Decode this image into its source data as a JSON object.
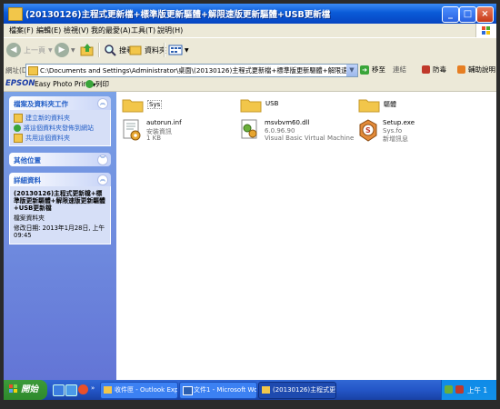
{
  "window": {
    "title": "(20130126)主程式更新檔+標準版更新驅體+解限速版更新驅體+USB更新檔"
  },
  "menu": [
    "檔案(F)",
    "編輯(E)",
    "檢視(V)",
    "我的最愛(A)",
    "工具(T)",
    "說明(H)"
  ],
  "toolbar": {
    "back": "上一頁",
    "search": "搜尋",
    "folders": "資料夾"
  },
  "address": {
    "label": "網址(D)",
    "path": "C:\\Documents and Settings\\Administrator\\桌面\\(20130126)主程式更新檔+標準版更新驅體+解限速版更新驅體+USB更新檔",
    "go": "移至",
    "links": "連結",
    "antivirus": "防毒",
    "help": "輔助說明"
  },
  "epson": {
    "logo": "EPSON",
    "app": "Easy Photo Print",
    "print": "列印"
  },
  "tasks_panel": {
    "title": "檔案及資料夾工作",
    "items": [
      "建立新的資料夾",
      "將這個資料夾發佈到網站",
      "共用這個資料夾"
    ]
  },
  "other_panel": {
    "title": "其他位置"
  },
  "details_panel": {
    "title": "詳細資料",
    "name": "(20130126)主程式更新檔+標準版更新驅體+解限速版更新驅體+USB更新檔",
    "type": "檔案資料夾",
    "modified": "修改日期: 2013年1月28日, 上午 09:45"
  },
  "files": [
    {
      "name": "Sys",
      "type": "folder"
    },
    {
      "name": "USB",
      "type": "folder"
    },
    {
      "name": "驅體",
      "type": "folder"
    },
    {
      "name": "autorun.inf",
      "line2": "安裝資訊",
      "line3": "1 KB",
      "type": "inf"
    },
    {
      "name": "msvbvm60.dll",
      "line2": "6.0.96.90",
      "line3": "Visual Basic Virtual Machine",
      "type": "dll"
    },
    {
      "name": "Setup.exe",
      "line2": "Sys.fo",
      "line3": "新增訊息",
      "type": "exe"
    }
  ],
  "taskbar": {
    "start": "開始",
    "tasks": [
      "收件匣 - Outlook Exp...",
      "文件1 - Microsoft Word",
      "(20130126)主程式更..."
    ],
    "clock": "上午 1"
  },
  "colors": {
    "titlebar": "#0A5BD8",
    "start": "#3C9A3A",
    "panel": "#D6DFF7",
    "sidebar": "#6F8FE0"
  }
}
